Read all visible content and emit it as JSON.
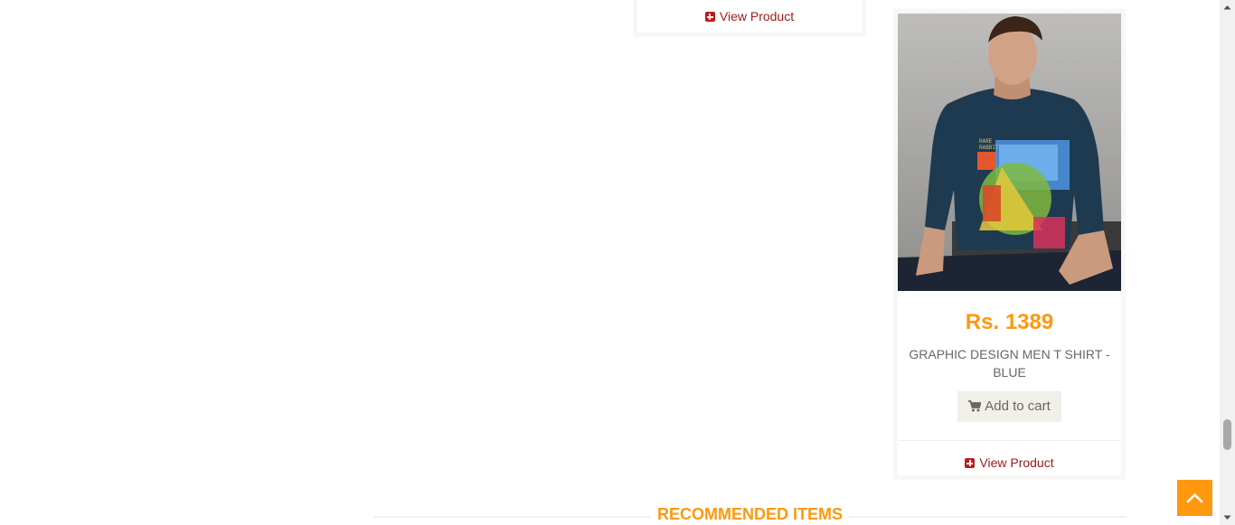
{
  "top_card": {
    "view_product_label": "View Product"
  },
  "product": {
    "image_alt": "Model wearing graphic design t-shirt",
    "price": "Rs. 1389",
    "name": "GRAPHIC DESIGN MEN T SHIRT - BLUE",
    "add_to_cart_label": "Add to cart",
    "view_product_label": "View Product"
  },
  "recommended": {
    "title": "RECOMMENDED ITEMS"
  },
  "icons": {
    "plus": "plus-square-icon",
    "cart": "shopping-cart-icon",
    "scroll_top": "chevron-up-icon"
  },
  "colors": {
    "accent": "#fe980f",
    "link": "#a11b1b",
    "text": "#696763",
    "card_bg": "#f7f7f5",
    "button_bg": "#f0f0e9"
  }
}
